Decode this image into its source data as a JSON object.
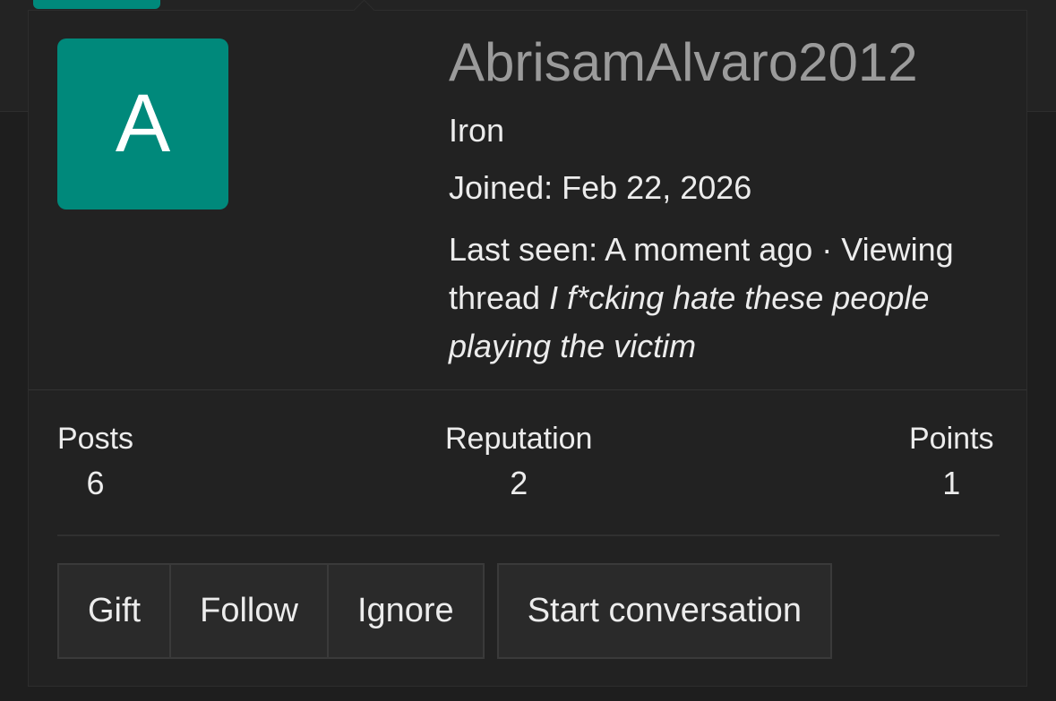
{
  "profile": {
    "avatar_letter": "A",
    "username": "AbrisamAlvaro2012",
    "rank": "Iron",
    "joined_label": "Joined:",
    "joined_date": "Feb 22, 2026",
    "last_seen_label": "Last seen:",
    "last_seen_value": "A moment ago",
    "activity_prefix": "· Viewing thread",
    "activity_thread": "I f*cking hate these people playing the victim"
  },
  "stats": {
    "posts_label": "Posts",
    "posts_value": "6",
    "reputation_label": "Reputation",
    "reputation_value": "2",
    "points_label": "Points",
    "points_value": "1"
  },
  "actions": {
    "gift": "Gift",
    "follow": "Follow",
    "ignore": "Ignore",
    "start_conversation": "Start conversation"
  },
  "colors": {
    "avatar_bg": "#00897b",
    "card_bg": "#222222",
    "username": "#9b9b9b"
  }
}
